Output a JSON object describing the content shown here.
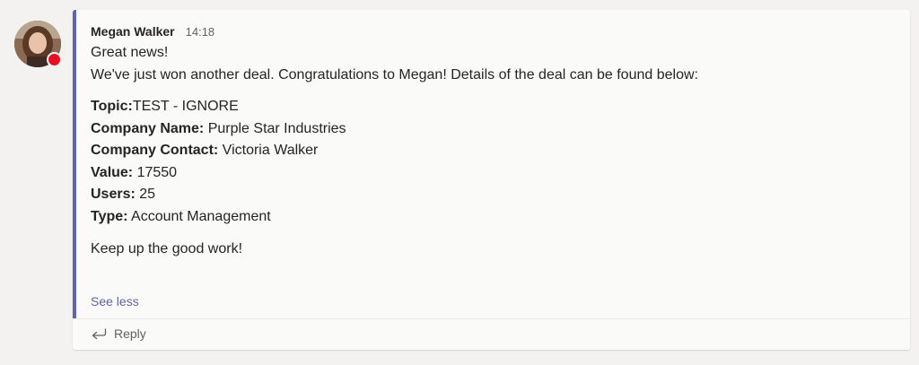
{
  "message": {
    "author": "Megan Walker",
    "time": "14:18",
    "greeting": "Great news!",
    "intro": "We've just won another deal. Congratulations to Megan! Details of the deal can be found below:",
    "details": [
      {
        "label": "Topic:",
        "value": "TEST - IGNORE"
      },
      {
        "label": "Company Name:",
        "value": " Purple Star Industries"
      },
      {
        "label": "Company Contact:",
        "value": " Victoria Walker"
      },
      {
        "label": "Value:",
        "value": " 17550"
      },
      {
        "label": "Users:",
        "value": " 25"
      },
      {
        "label": "Type:",
        "value": " Account Management"
      }
    ],
    "closing": "Keep up the good work!",
    "see_less": "See less"
  },
  "reply": {
    "label": "Reply",
    "icon": "reply-arrow-icon"
  },
  "colors": {
    "accent": "#6264a7",
    "presence_busy": "#e81123",
    "background": "#f3f2f1",
    "card": "#fafaf9"
  }
}
